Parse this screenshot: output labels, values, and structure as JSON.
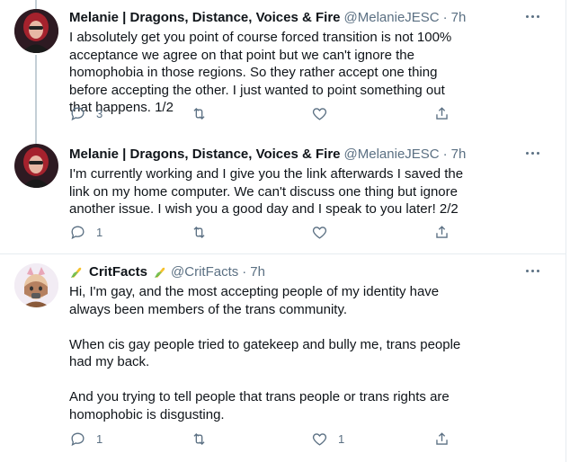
{
  "tweets": [
    {
      "name": "Melanie | Dragons, Distance, Voices & Fire",
      "handle": "@MelanieJESC",
      "separator": "·",
      "time": "7h",
      "text": "I absolutely get you point of course forced transition is not 100% acceptance we agree on that point but we can't ignore the homophobia in those regions. So they rather accept one thing before accepting the other. I just wanted to point something out that happens. 1/2",
      "reply_count": "3",
      "retweet_count": "",
      "like_count": ""
    },
    {
      "name": "Melanie | Dragons, Distance, Voices & Fire",
      "handle": "@MelanieJESC",
      "separator": "·",
      "time": "7h",
      "text": "I'm currently working and I give you the link afterwards I saved the link on my home computer. We can't discuss one thing but ignore another issue. I wish you a good day and I speak to you later! 2/2",
      "reply_count": "1",
      "retweet_count": "",
      "like_count": ""
    },
    {
      "name": "CritFacts",
      "handle": "@CritFacts",
      "separator": "·",
      "time": "7h",
      "text": "Hi, I'm gay, and the most accepting people of my identity have always been members of the trans community.\n\nWhen cis gay people tried to gatekeep and bully me, trans people had my back.\n\nAnd you trying to tell people that trans people or trans rights are homophobic is disgusting.",
      "reply_count": "1",
      "retweet_count": "",
      "like_count": "1"
    }
  ],
  "colors": {
    "text": "#0f1419",
    "muted": "#5b7083",
    "divider": "#e6ecf0",
    "thread": "#c4cfd6"
  }
}
